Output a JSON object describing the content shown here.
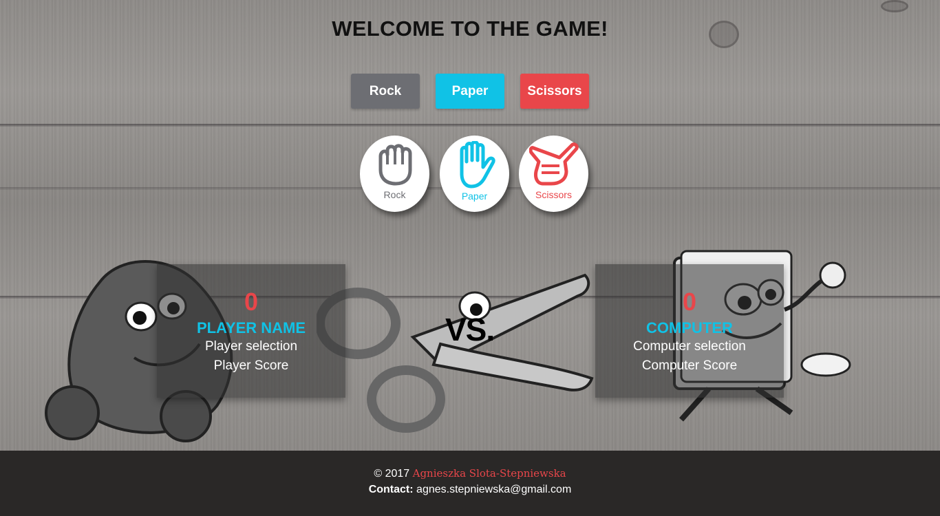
{
  "game": {
    "title": "WELCOME TO THE GAME!",
    "buttons": {
      "rock": "Rock",
      "paper": "Paper",
      "scissors": "Scissors"
    },
    "hands": {
      "rock": "Rock",
      "paper": "Paper",
      "scissors": "Scissors"
    },
    "player": {
      "score": "0",
      "name": "PLAYER NAME",
      "selection": "Player selection",
      "score_label": "Player Score"
    },
    "vs": "VS.",
    "computer": {
      "score": "0",
      "name": "COMPUTER",
      "selection": "Computer selection",
      "score_label": "Computer Score"
    }
  },
  "colors": {
    "rock": "#6d6e73",
    "paper": "#10c2e6",
    "scissors": "#e9464a",
    "footer": "#2a2827"
  },
  "icons": {
    "rock": "fist-icon",
    "paper": "open-hand-icon",
    "scissors": "scissors-hand-icon"
  },
  "footer": {
    "copyright": "© 2017",
    "author": "Agnieszka Slota-Stepniewska",
    "contact_label": "Contact:",
    "email": "agnes.stepniewska@gmail.com"
  }
}
